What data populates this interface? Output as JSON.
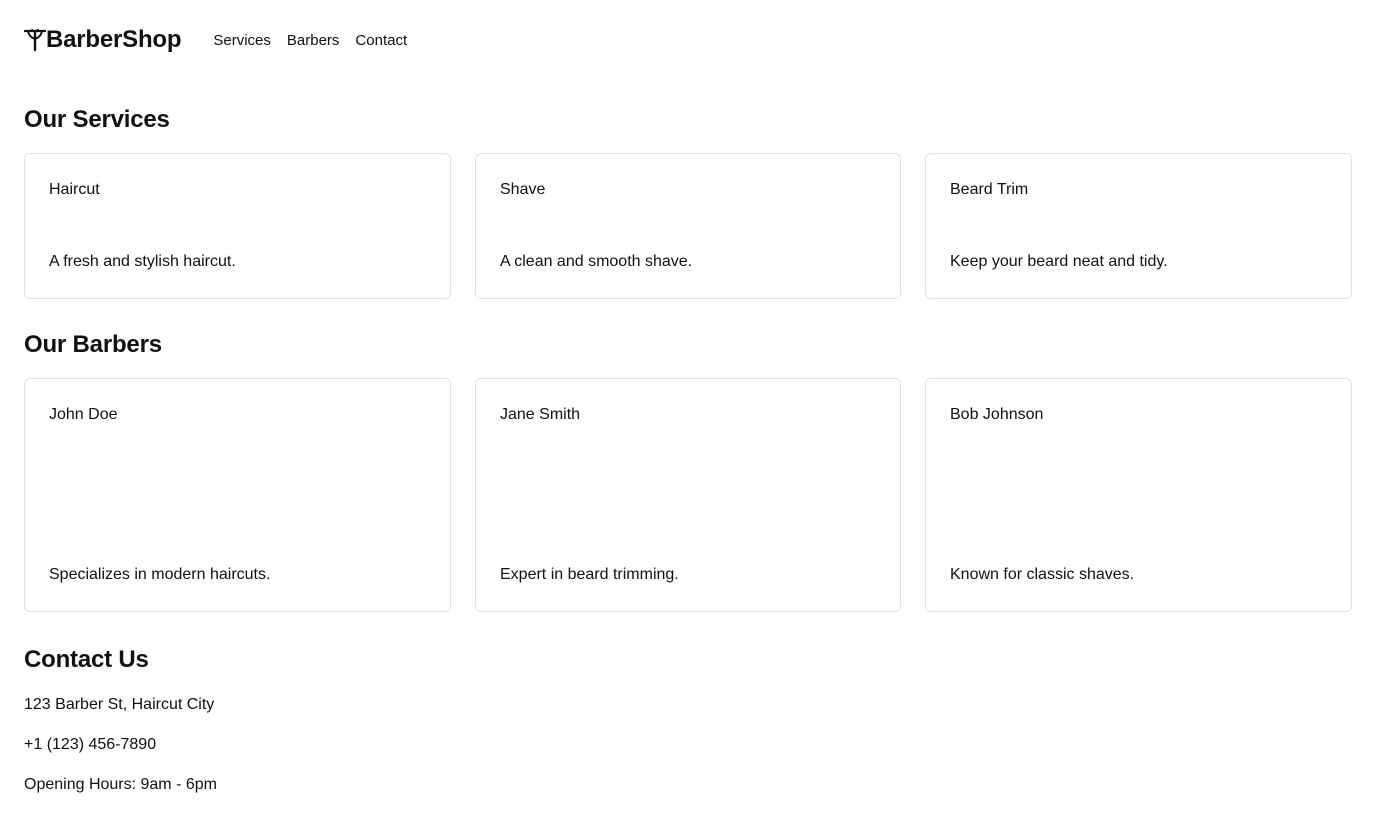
{
  "header": {
    "brand_name": "BarberShop",
    "brand_icon": "scissors-comb-icon",
    "nav": [
      {
        "label": "Services"
      },
      {
        "label": "Barbers"
      },
      {
        "label": "Contact"
      }
    ]
  },
  "services": {
    "title": "Our Services",
    "items": [
      {
        "name": "Haircut",
        "description": "A fresh and stylish haircut."
      },
      {
        "name": "Shave",
        "description": "A clean and smooth shave."
      },
      {
        "name": "Beard Trim",
        "description": "Keep your beard neat and tidy."
      }
    ]
  },
  "barbers": {
    "title": "Our Barbers",
    "items": [
      {
        "name": "John Doe",
        "description": "Specializes in modern haircuts."
      },
      {
        "name": "Jane Smith",
        "description": "Expert in beard trimming."
      },
      {
        "name": "Bob Johnson",
        "description": "Known for classic shaves."
      }
    ]
  },
  "contact": {
    "title": "Contact Us",
    "address": "123 Barber St, Haircut City",
    "phone": "+1 (123) 456-7890",
    "hours": "Opening Hours: 9am - 6pm"
  }
}
